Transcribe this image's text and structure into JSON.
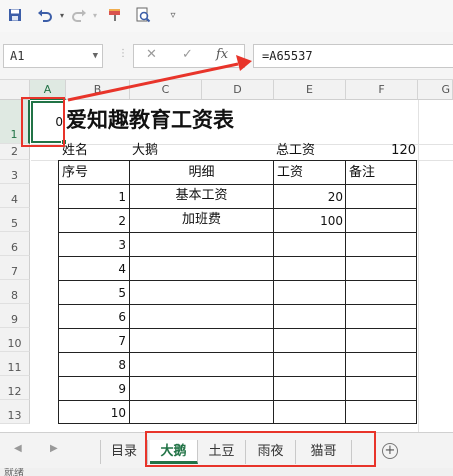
{
  "toolbar": {
    "save_icon": "save-icon",
    "undo_icon": "undo-icon",
    "redo_icon": "redo-icon",
    "format_painter_icon": "format-painter-icon",
    "print_preview_icon": "print-preview-icon",
    "customize_icon": "customize-dropdown-icon"
  },
  "formula_bar": {
    "name_box": "A1",
    "cancel": "✕",
    "confirm": "✓",
    "fx": "fx",
    "formula": "=A65537"
  },
  "columns": [
    "A",
    "B",
    "C",
    "D",
    "E",
    "F",
    "G"
  ],
  "rows": [
    "1",
    "2",
    "3",
    "4",
    "5",
    "6",
    "7",
    "8",
    "9",
    "10",
    "11",
    "12",
    "13"
  ],
  "cells": {
    "a1": "0",
    "title": "爱知趣教育工资表",
    "name_label": "姓名",
    "name_value": "大鹅",
    "total_label": "总工资",
    "total_value": "120",
    "hdr_seq": "序号",
    "hdr_detail": "明细",
    "hdr_wage": "工资",
    "hdr_note": "备注",
    "table_rows": [
      {
        "seq": "1",
        "detail": "基本工资",
        "wage": "20"
      },
      {
        "seq": "2",
        "detail": "加班费",
        "wage": "100"
      },
      {
        "seq": "3",
        "detail": "",
        "wage": ""
      },
      {
        "seq": "4",
        "detail": "",
        "wage": ""
      },
      {
        "seq": "5",
        "detail": "",
        "wage": ""
      },
      {
        "seq": "6",
        "detail": "",
        "wage": ""
      },
      {
        "seq": "7",
        "detail": "",
        "wage": ""
      },
      {
        "seq": "8",
        "detail": "",
        "wage": ""
      },
      {
        "seq": "9",
        "detail": "",
        "wage": ""
      },
      {
        "seq": "10",
        "detail": "",
        "wage": ""
      }
    ]
  },
  "tabs": [
    "目录",
    "大鹅",
    "土豆",
    "雨夜",
    "猫哥"
  ],
  "active_tab": "大鹅",
  "add_sheet": "+",
  "status": "就绪",
  "colors": {
    "accent": "#217346",
    "highlight": "#e8342a"
  }
}
